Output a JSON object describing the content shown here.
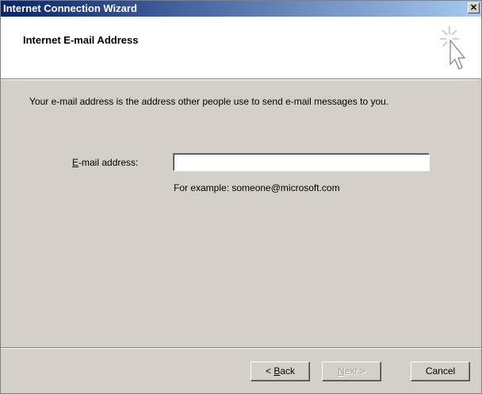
{
  "window": {
    "title": "Internet Connection Wizard",
    "close_label": "✕"
  },
  "header": {
    "heading": "Internet E-mail Address",
    "icon": "wizard-cursor-icon"
  },
  "body": {
    "description": "Your e-mail address is the address other people use to send e-mail messages to you.",
    "email_label_accel": "E",
    "email_label_rest": "-mail address:",
    "email_value": "",
    "example": "For example: someone@microsoft.com"
  },
  "buttons": {
    "back_prefix": "< ",
    "back_accel": "B",
    "back_rest": "ack",
    "next_accel": "N",
    "next_rest": "ext >",
    "cancel": "Cancel"
  }
}
